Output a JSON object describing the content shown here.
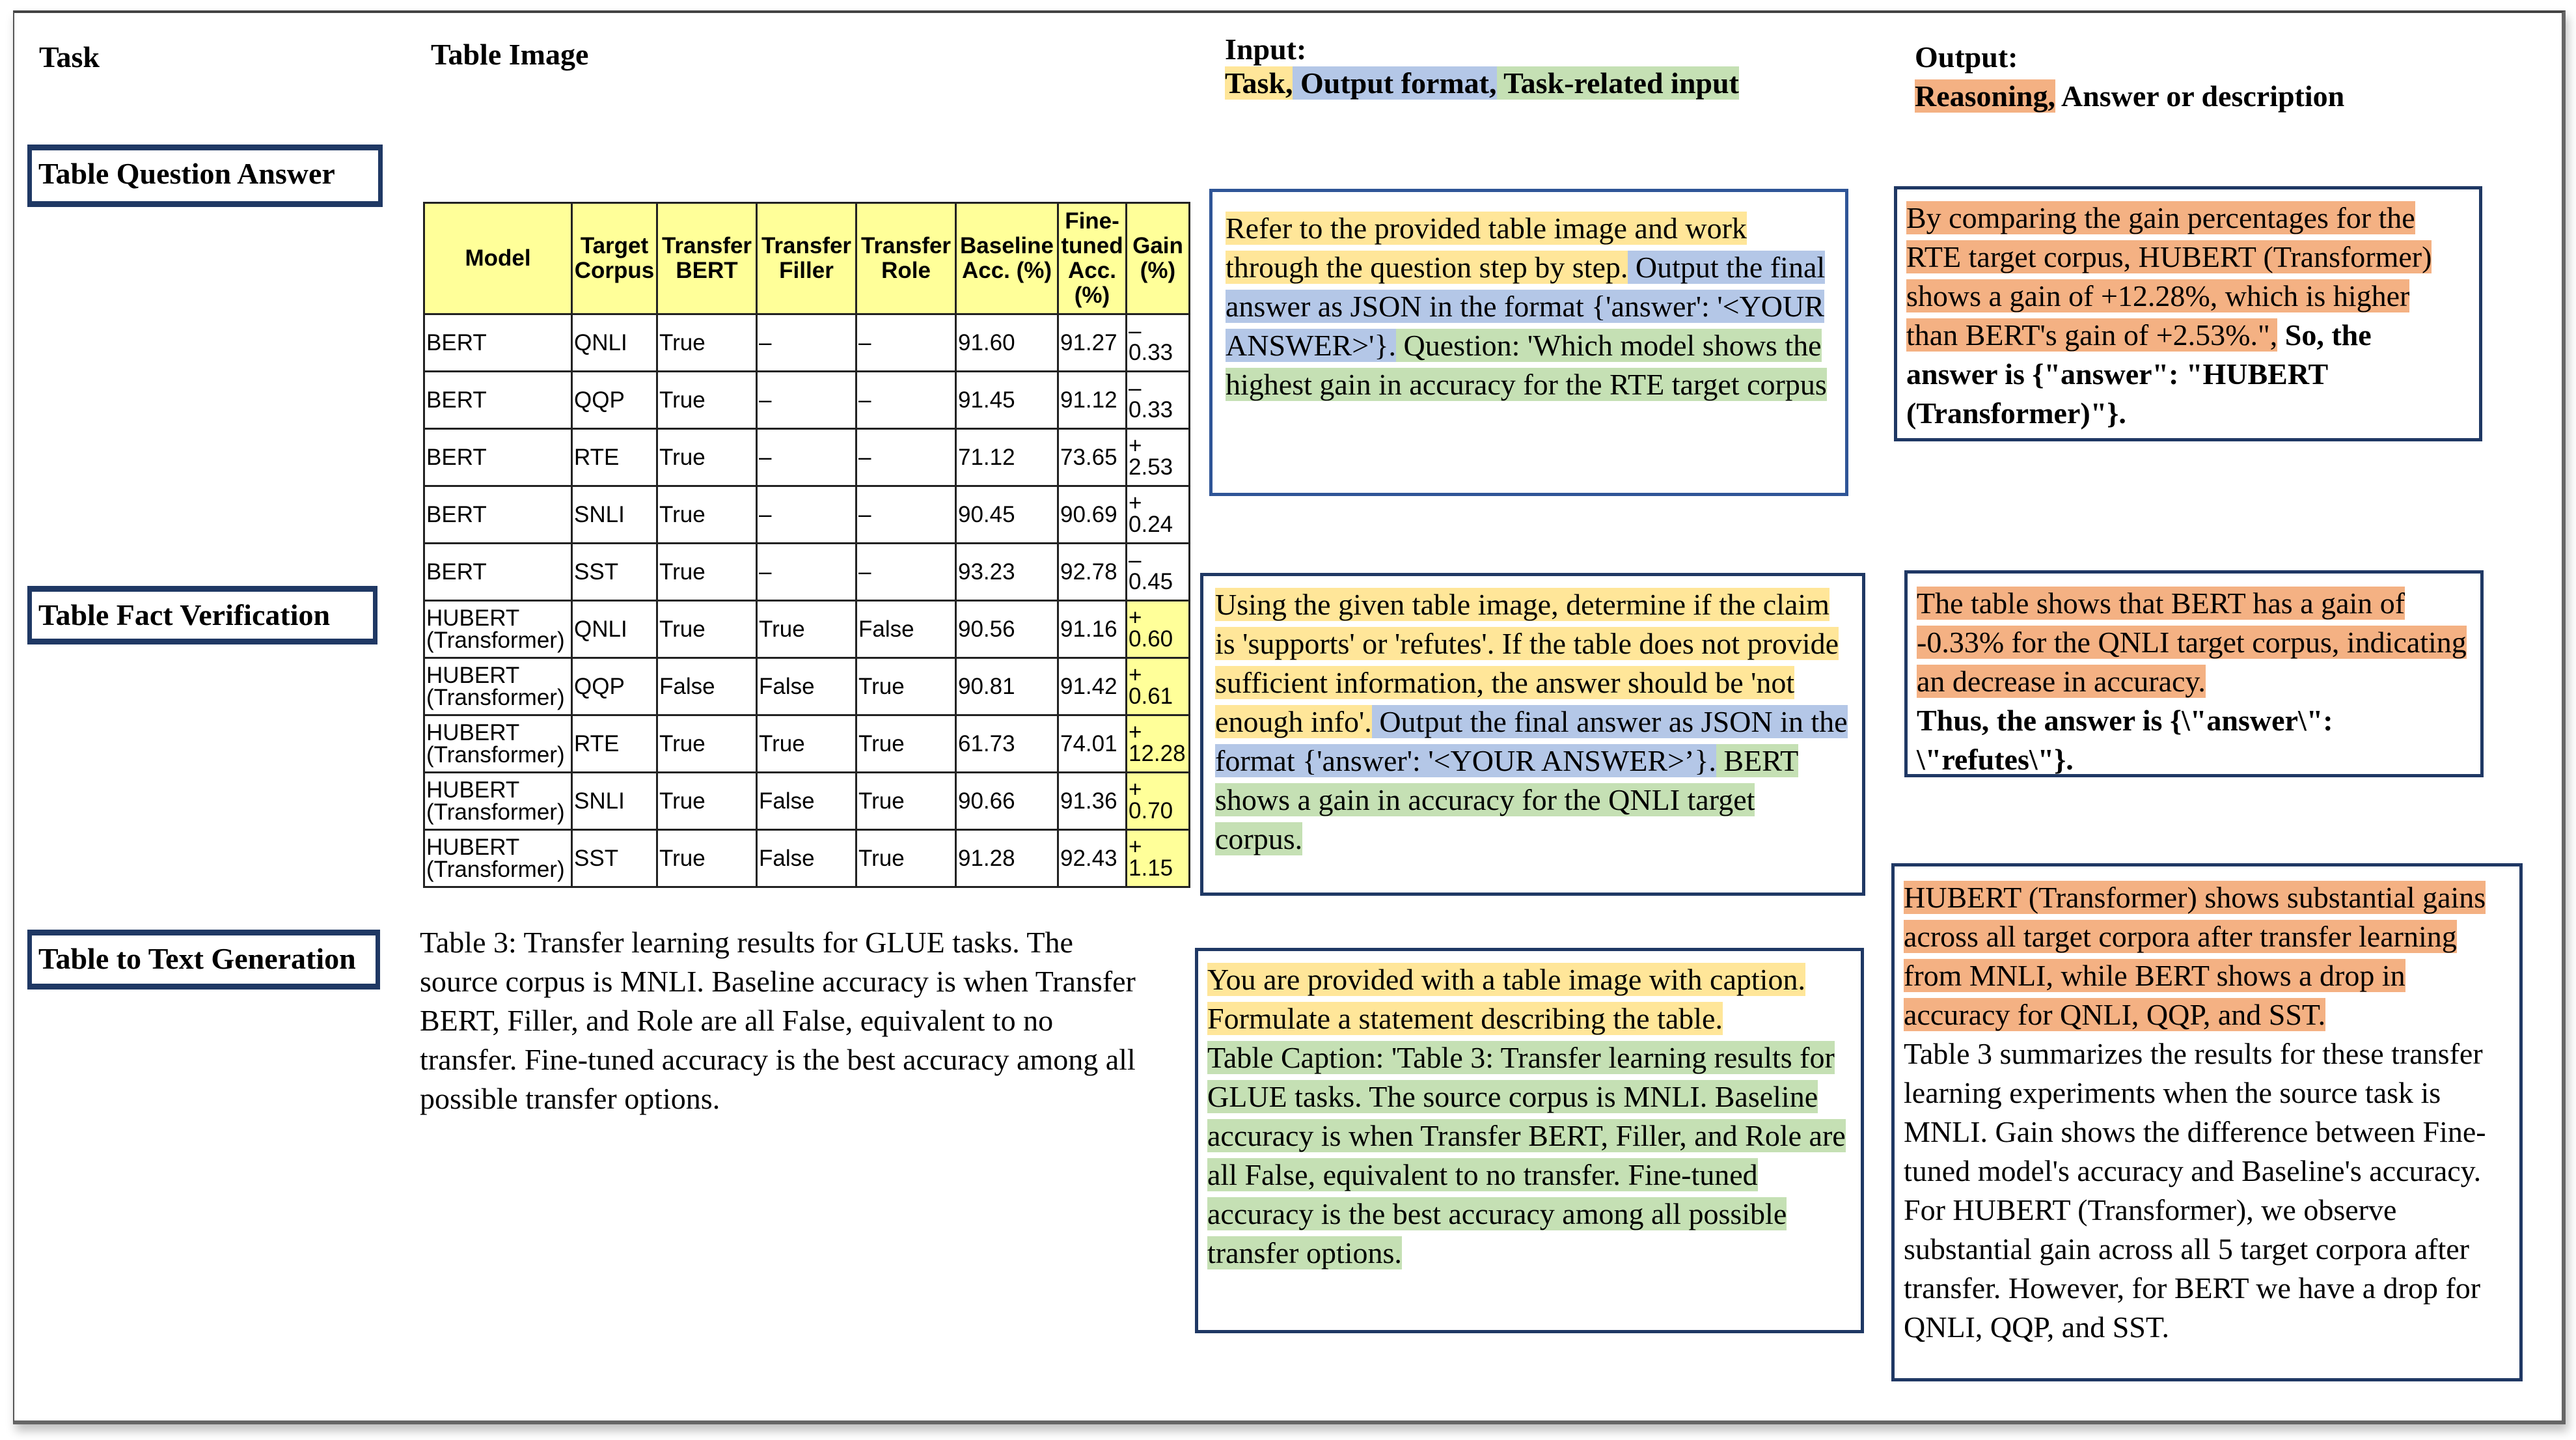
{
  "headers": {
    "task": "Task",
    "table_image": "Table Image",
    "input_title": "Input:",
    "input_legend": [
      {
        "text": "Task,",
        "kind": "task"
      },
      {
        "text": " Output format,",
        "kind": "fmt"
      },
      {
        "text": " Task-related input",
        "kind": "input"
      }
    ],
    "output_title": "Output:",
    "output_legend": [
      {
        "text": "Reasoning,",
        "kind": "reason"
      },
      {
        "text": " Answer or description",
        "kind": "plain"
      }
    ]
  },
  "highlight_colors": {
    "task": "#ffe699",
    "output_format": "#b4c7e7",
    "task_related_input": "#c5e0b4",
    "reasoning": "#f4b183",
    "table_header": "#ffff99",
    "box_border": "#1f3864"
  },
  "tasks": [
    {
      "label": "Table Question Answer"
    },
    {
      "label": "Table Fact Verification"
    },
    {
      "label": "Table to Text Generation"
    }
  ],
  "table": {
    "columns": [
      "Model",
      "Target Corpus",
      "Transfer BERT",
      "Transfer Filler",
      "Transfer Role",
      "Baseline Acc. (%)",
      "Fine-tuned Acc. (%)",
      "Gain (%)"
    ],
    "rows": [
      {
        "model": "BERT",
        "corpus": "QNLI",
        "bert": "True",
        "filler": "–",
        "role": "–",
        "baseline": "91.60",
        "finetuned": "91.27",
        "gain": "– 0.33"
      },
      {
        "model": "BERT",
        "corpus": "QQP",
        "bert": "True",
        "filler": "–",
        "role": "–",
        "baseline": "91.45",
        "finetuned": "91.12",
        "gain": "– 0.33"
      },
      {
        "model": "BERT",
        "corpus": "RTE",
        "bert": "True",
        "filler": "–",
        "role": "–",
        "baseline": "71.12",
        "finetuned": "73.65",
        "gain": "+ 2.53"
      },
      {
        "model": "BERT",
        "corpus": "SNLI",
        "bert": "True",
        "filler": "–",
        "role": "–",
        "baseline": "90.45",
        "finetuned": "90.69",
        "gain": "+ 0.24"
      },
      {
        "model": "BERT",
        "corpus": "SST",
        "bert": "True",
        "filler": "–",
        "role": "–",
        "baseline": "93.23",
        "finetuned": "92.78",
        "gain": "– 0.45"
      },
      {
        "model": "HUBERT (Transformer)",
        "corpus": "QNLI",
        "bert": "True",
        "filler": "True",
        "role": "False",
        "baseline": "90.56",
        "finetuned": "91.16",
        "gain": "+ 0.60"
      },
      {
        "model": "HUBERT (Transformer)",
        "corpus": "QQP",
        "bert": "False",
        "filler": "False",
        "role": "True",
        "baseline": "90.81",
        "finetuned": "91.42",
        "gain": "+ 0.61"
      },
      {
        "model": "HUBERT (Transformer)",
        "corpus": "RTE",
        "bert": "True",
        "filler": "True",
        "role": "True",
        "baseline": "61.73",
        "finetuned": "74.01",
        "gain": "+ 12.28"
      },
      {
        "model": "HUBERT (Transformer)",
        "corpus": "SNLI",
        "bert": "True",
        "filler": "False",
        "role": "True",
        "baseline": "90.66",
        "finetuned": "91.36",
        "gain": "+ 0.70"
      },
      {
        "model": "HUBERT (Transformer)",
        "corpus": "SST",
        "bert": "True",
        "filler": "False",
        "role": "True",
        "baseline": "91.28",
        "finetuned": "92.43",
        "gain": "+ 1.15"
      }
    ]
  },
  "caption": "Table 3: Transfer learning results for GLUE tasks. The source corpus is MNLI. Baseline accuracy is when Transfer BERT, Filler, and Role are all False, equivalent to no transfer. Fine-tuned accuracy is the best accuracy among all possible transfer options.",
  "inputs": [
    {
      "segments": [
        {
          "kind": "task",
          "text": "Refer to the provided table image and work through the question step by step."
        },
        {
          "kind": "fmt",
          "text": " Output the final answer as JSON in the format {'answer': '<YOUR ANSWER>'}."
        },
        {
          "kind": "input",
          "text": " Question: 'Which model shows the highest gain in accuracy for the RTE target corpus"
        }
      ]
    },
    {
      "segments": [
        {
          "kind": "task",
          "text": "Using the given table image, determine if the claim is 'supports' or 'refutes'. If the table does not provide sufficient information, the answer should be 'not enough info'."
        },
        {
          "kind": "fmt",
          "text": " Output the final answer as JSON in the format {'answer': '<YOUR ANSWER>’}."
        },
        {
          "kind": "input",
          "text": " BERT shows a gain in accuracy for the QNLI target corpus."
        }
      ]
    },
    {
      "segments": [
        {
          "kind": "task",
          "text": "You are provided with a table image with caption. Formulate a statement describing the table."
        },
        {
          "kind": "break",
          "text": ""
        },
        {
          "kind": "input",
          "text": "Table Caption: 'Table 3: Transfer learning results for GLUE tasks. The source corpus is MNLI. Baseline accuracy is when Transfer BERT, Filler, and Role are all False, equivalent to no transfer. Fine-tuned accuracy is the best accuracy among all possible transfer options."
        }
      ]
    }
  ],
  "outputs": [
    {
      "segments": [
        {
          "kind": "reason",
          "text": "By comparing the gain percentages for the RTE target corpus, HUBERT (Transformer) shows a gain of +12.28%, which is higher than BERT's gain of +2.53%.\","
        },
        {
          "kind": "answer",
          "text": " So, the answer is {\"answer\": \"HUBERT (Transformer)\"}."
        }
      ]
    },
    {
      "segments": [
        {
          "kind": "reason",
          "text": "The table shows that BERT has a gain of -0.33% for the QNLI target corpus, indicating an decrease in accuracy."
        },
        {
          "kind": "break",
          "text": ""
        },
        {
          "kind": "answer",
          "text": "Thus, the answer is {\\\"answer\\\": \\\"refutes\\\"}."
        }
      ]
    },
    {
      "segments": [
        {
          "kind": "reason",
          "text": "HUBERT (Transformer) shows substantial gains across all target corpora after transfer learning from MNLI, while BERT shows a drop in accuracy for QNLI, QQP, and SST."
        },
        {
          "kind": "break",
          "text": ""
        },
        {
          "kind": "plain",
          "text": "Table 3 summarizes the results for these transfer learning experiments when the source task is MNLI. Gain shows the difference between Fine-tuned model's accuracy and Baseline's accuracy. For HUBERT (Transformer), we observe substantial gain across all 5 target corpora after transfer. However, for BERT we have a drop for QNLI, QQP, and SST."
        }
      ]
    }
  ]
}
